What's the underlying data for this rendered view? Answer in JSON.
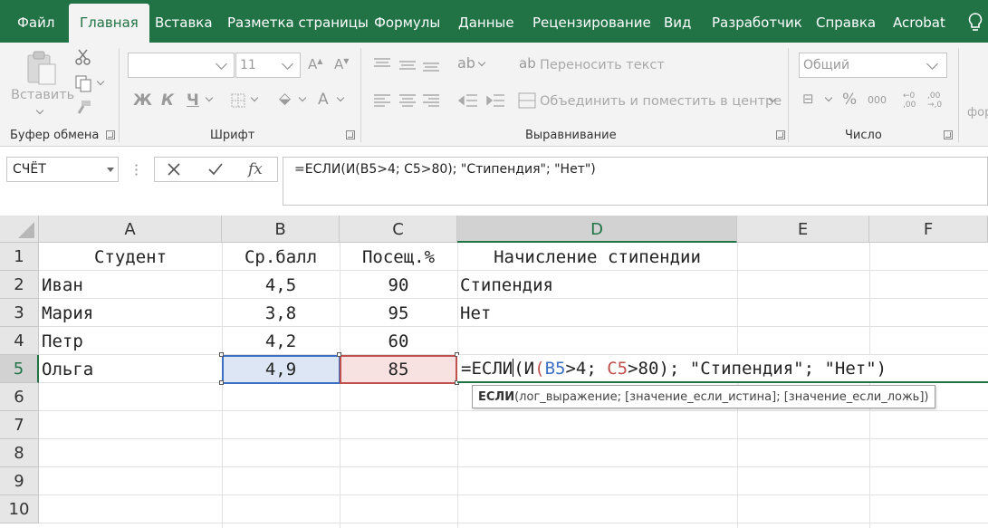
{
  "menu": {
    "tabs": [
      "Файл",
      "Главная",
      "Вставка",
      "Разметка страницы",
      "Формулы",
      "Данные",
      "Рецензирование",
      "Вид",
      "Разработчик",
      "Справка",
      "Acrobat"
    ],
    "active_index": 1
  },
  "ribbon": {
    "clipboard": {
      "paste_label": "Вставить",
      "group_label": "Буфер обмена"
    },
    "font": {
      "font_name": "",
      "font_size": "11",
      "bold_label": "Ж",
      "italic_label": "К",
      "underline_label": "Ч",
      "group_label": "Шрифт"
    },
    "alignment": {
      "wrap_label": "Переносить текст",
      "merge_label": "Объединить и поместить в центре",
      "group_label": "Выравнивание"
    },
    "number": {
      "format": "Общий",
      "percent_label": "%",
      "thousands_label": "000",
      "group_label": "Число"
    },
    "styles": {
      "partial_label": "фор"
    }
  },
  "formula_bar": {
    "name_box": "СЧЁТ",
    "fx_label": "fx",
    "formula": "=ЕСЛИ(И(B5>4; C5>80); \"Стипендия\"; \"Нет\")"
  },
  "sheet": {
    "columns": [
      "A",
      "B",
      "C",
      "D",
      "E",
      "F"
    ],
    "rows": [
      "1",
      "2",
      "3",
      "4",
      "5",
      "6",
      "7",
      "8",
      "9",
      "10"
    ],
    "cells": [
      [
        "Студент",
        "Ср.балл",
        "Посещ.%",
        "Начисление стипендии"
      ],
      [
        "Иван",
        "4,5",
        "90",
        "Стипендия"
      ],
      [
        "Мария",
        "3,8",
        "95",
        "Нет"
      ],
      [
        "Петр",
        "4,2",
        "60",
        ""
      ],
      [
        "Ольга",
        "4,9",
        "85",
        ""
      ]
    ],
    "editing": {
      "prefix": "=ЕСЛИ",
      "open1": "(",
      "func2": "И",
      "open2": "(",
      "ref1": "B5",
      "cond1": ">4; ",
      "ref2": "C5",
      "cond2": ">80",
      "rest": "); \"Стипендия\"; \"Нет\")"
    },
    "tooltip": {
      "func": "ЕСЛИ",
      "args": "(лог_выражение; [значение_если_истина]; [значение_если_ложь])"
    }
  },
  "colors": {
    "brand": "#217346",
    "ref_blue": "#3a6fc4",
    "ref_red": "#c0504d"
  }
}
